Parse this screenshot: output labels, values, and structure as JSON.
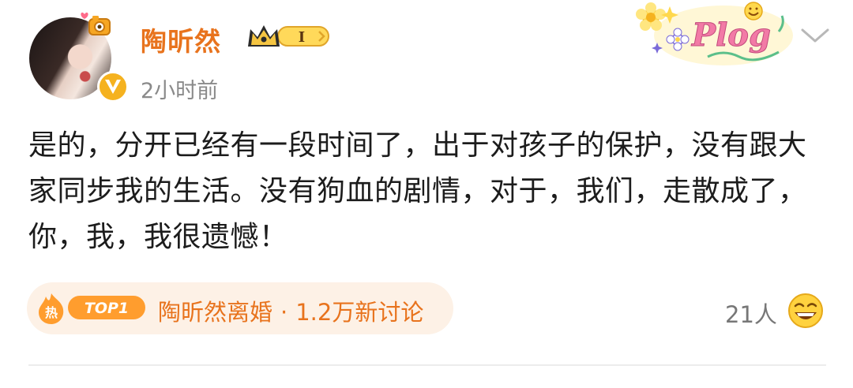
{
  "post": {
    "author": {
      "name": "陶昕然",
      "vip_level": "I"
    },
    "timestamp": "2小时前",
    "text": "是的，分开已经有一段时间了，出于对孩子的保护，没有跟大家同步我的生活。没有狗血的剧情，对于，我们，走散成了，你，我，我很遗憾！",
    "topic": {
      "hot_glyph": "热",
      "rank": "TOP1",
      "name": "陶昕然离婚",
      "separator": "·",
      "discussion": "1.2万新讨论"
    },
    "reactions": {
      "count": "21人"
    },
    "sticker_text": "Plog"
  },
  "colors": {
    "accent": "#e8731d",
    "topic_bg": "#fdf1e6",
    "gold": "#f5b21f"
  },
  "icons": [
    "avatar-decoration-icon",
    "verified-v-icon",
    "vip-crown-icon",
    "plog-sticker-icon",
    "chevron-down-icon",
    "hot-icon",
    "laugh-emoji-icon"
  ]
}
